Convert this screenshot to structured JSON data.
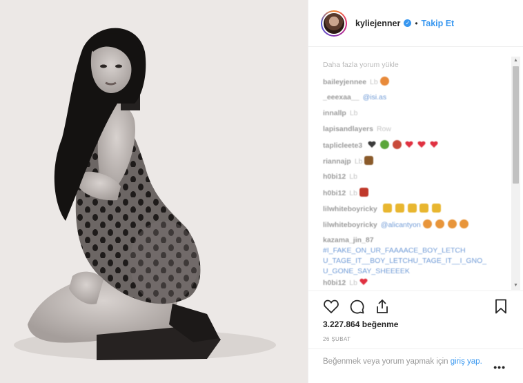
{
  "header": {
    "username": "kyliejenner",
    "separator": "•",
    "follow_label": "Takip Et"
  },
  "comments": {
    "load_more": "Daha fazla yorum yükle",
    "items": [
      {
        "user": "baileyjennee",
        "text": "Lb",
        "emoji": [
          "#e88a3a"
        ]
      },
      {
        "user": "_eeexaa__",
        "text": "@isi.as",
        "mention": true
      },
      {
        "user": "innallp",
        "text": "Lb"
      },
      {
        "user": "lapisandlayers",
        "text": "Row"
      },
      {
        "user": "taplicleete3",
        "text": "",
        "hearts": 6
      },
      {
        "user": "riannajp",
        "text": "Lb",
        "emoji": [
          "#8a5a2a"
        ]
      },
      {
        "user": "h0bi12",
        "text": "Lb"
      },
      {
        "user": "h0bi12",
        "text": "Lb",
        "emoji": [
          "#c0392b"
        ]
      },
      {
        "user": "lilwhiteboyricky",
        "text": "",
        "emoji": [
          "#e8b630",
          "#e8b630",
          "#e8b630",
          "#e8b630",
          "#e8b630"
        ]
      },
      {
        "user": "lilwhiteboyricky",
        "text": "@alicantyon",
        "mention": true,
        "emoji": [
          "#e8953a",
          "#e8953a",
          "#e8953a",
          "#e8953a",
          "#e8953a"
        ]
      },
      {
        "user": "kazama_jin_87",
        "text": "#I_FAKE_ON_UR_FAAAACE_BOY_LETCH U_TAGE_IT__BOY_LETCHU_TAGE_IT__I_GNO_ U_GONE_SAY_SHEEEEK",
        "mention": true,
        "multiline": true
      },
      {
        "user": "h0bi12",
        "text": "Lb",
        "hearts": 1
      }
    ]
  },
  "likes": {
    "count": "3.227.864",
    "label": "beğenme"
  },
  "date": "26 ŞUBAT",
  "login": {
    "prefix": "Beğenmek veya yorum yapmak için",
    "link_word_1": "giriş",
    "link_word_2": "yap.",
    "more": "•••"
  },
  "icons": {
    "like": "heart-outline-icon",
    "comment": "comment-bubble-icon",
    "share": "share-arrow-icon",
    "save": "bookmark-icon"
  },
  "colors": {
    "link_blue": "#3897f0",
    "text_dark": "#262626",
    "muted": "#999999"
  }
}
